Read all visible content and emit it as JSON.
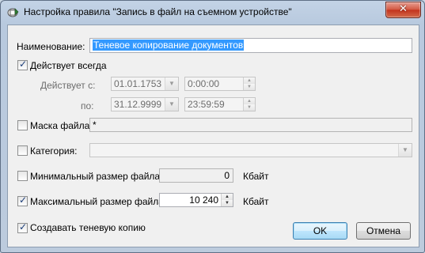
{
  "window": {
    "title": "Настройка правила \"Запись в файл на съемном устройстве\"",
    "close_glyph": "✕"
  },
  "form": {
    "name_label": "Наименование:",
    "name_value": "Теневое копирование документов",
    "always_active": {
      "label": "Действует всегда",
      "checked": true
    },
    "active_from_label": "Действует с:",
    "active_from_date": "01.01.1753",
    "active_from_time": "0:00:00",
    "active_to_label": "по:",
    "active_to_date": "31.12.9999",
    "active_to_time": "23:59:59",
    "file_mask": {
      "label": "Маска файла:",
      "checked": false,
      "value": "*"
    },
    "category": {
      "label": "Категория:",
      "checked": false,
      "value": ""
    },
    "min_size": {
      "label": "Минимальный размер файла:",
      "checked": false,
      "value": "0",
      "unit": "Кбайт"
    },
    "max_size": {
      "label": "Максимальный размер файла:",
      "checked": true,
      "value": "10 240",
      "unit": "Кбайт"
    },
    "shadow_copy": {
      "label": "Создавать теневую копию",
      "checked": true
    }
  },
  "buttons": {
    "ok": "OK",
    "cancel": "Отмена"
  },
  "icons": {
    "app": "rule-settings-icon",
    "dropdown": "chevron-down-icon",
    "spin_up": "arrow-up-icon",
    "spin_down": "arrow-down-icon",
    "check": "checkmark-icon"
  },
  "glyphs": {
    "check": "✓",
    "down": "▼",
    "up": "▲"
  }
}
